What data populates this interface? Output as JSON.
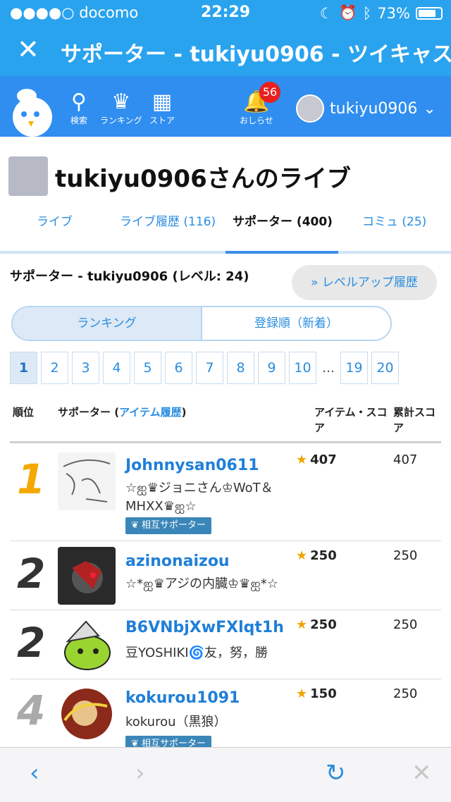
{
  "status": {
    "carrier": "●●●●○ docomo",
    "time": "22:29",
    "battery": "73%"
  },
  "titlebar": {
    "title": "サポーター - tukiyu0906 - ツイキャス"
  },
  "nav": {
    "search": "検索",
    "ranking": "ランキング",
    "store": "ストア",
    "notifications": "おしらせ",
    "badge": "56",
    "username": "tukiyu0906"
  },
  "page": {
    "title": "tukiyu0906さんのライブ"
  },
  "tabs": [
    "ライブ",
    "ライブ履歴 (116)",
    "サポーター (400)",
    "コミュ (25)"
  ],
  "supporter_heading": "サポーター - tukiyu0906 (レベル: 24)",
  "levelup_button": "» レベルアップ履歴",
  "toggle": {
    "ranking": "ランキング",
    "registered": "登録順（新着）"
  },
  "pager": [
    "1",
    "2",
    "3",
    "4",
    "5",
    "6",
    "7",
    "8",
    "9",
    "10",
    "...",
    "19",
    "20"
  ],
  "table_header": {
    "rank": "順位",
    "supporter": "サポーター (",
    "item_history": "アイテム履歴",
    "supporter_close": ")",
    "item_score": "アイテム・スコア",
    "total_score": "累計スコア"
  },
  "rows": [
    {
      "rank": "1",
      "name": "Johnnysan0611",
      "desc": "☆ஐ♛ジョニさん♔WoT＆MHXX♛ஐ☆",
      "mutual": "相互サポーター",
      "score": "407",
      "total": "407"
    },
    {
      "rank": "2",
      "name": "azinonaizou",
      "desc": "☆*ஐ♛アジの内臓♔♛ஐ*☆",
      "mutual": "",
      "score": "250",
      "total": "250"
    },
    {
      "rank": "2",
      "name": "B6VNbjXwFXlqt1h",
      "desc": "豆YOSHIKI🌀友，努，勝",
      "mutual": "",
      "score": "250",
      "total": "250"
    },
    {
      "rank": "4",
      "name": "kokurou1091",
      "desc": "kokurou（黒狼）",
      "mutual": "相互サポーター",
      "score": "150",
      "total": "250"
    }
  ],
  "colors": {
    "brand": "#2aa3ee",
    "nav": "#2f8ef0",
    "link": "#2a8de0",
    "gold": "#f5a800"
  }
}
